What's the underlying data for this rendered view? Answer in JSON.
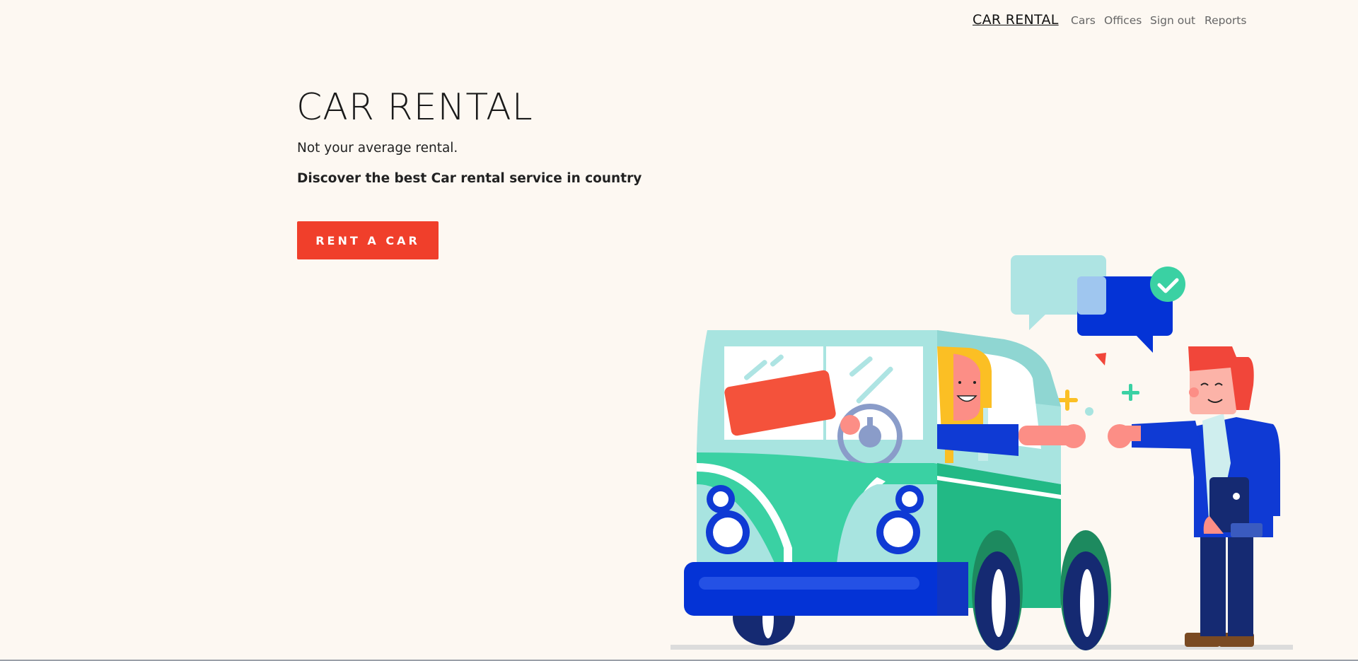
{
  "navbar": {
    "brand": "CAR RENTAL",
    "links": [
      {
        "label": "Cars"
      },
      {
        "label": "Offices"
      },
      {
        "label": "Sign out"
      },
      {
        "label": "Reports"
      }
    ]
  },
  "hero": {
    "title": "CAR RENTAL",
    "subtitle": "Not your average rental.",
    "lead": "Discover the best Car rental service in country",
    "cta_label": "RENT A CAR"
  },
  "illustration": {
    "icon": "car-rental-illustration",
    "colors": {
      "van_body": "#a8e4e0",
      "van_green": "#3ad1a3",
      "bumper": "#0433d6",
      "sign": "#f4523b",
      "wheel": "#152a72",
      "hair": "#f1463a",
      "driver_hair": "#fbbf24",
      "jacket": "#0f3ad4"
    }
  }
}
